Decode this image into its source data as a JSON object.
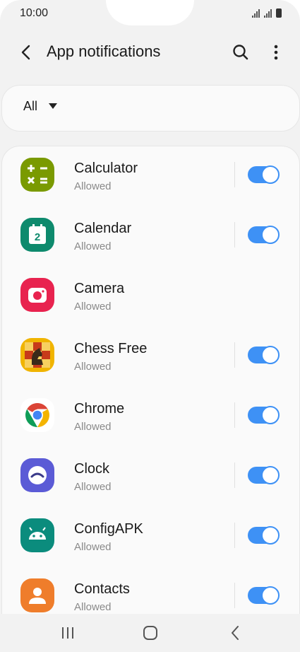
{
  "status": {
    "time": "10:00"
  },
  "header": {
    "title": "App notifications"
  },
  "filter": {
    "selected": "All"
  },
  "apps": [
    {
      "name": "Calculator",
      "status": "Allowed",
      "icon": "calculator-icon",
      "toggle": true,
      "enabled": true
    },
    {
      "name": "Calendar",
      "status": "Allowed",
      "icon": "calendar-icon",
      "toggle": true,
      "enabled": true
    },
    {
      "name": "Camera",
      "status": "Allowed",
      "icon": "camera-icon",
      "toggle": false,
      "enabled": true
    },
    {
      "name": "Chess Free",
      "status": "Allowed",
      "icon": "chess-icon",
      "toggle": true,
      "enabled": true
    },
    {
      "name": "Chrome",
      "status": "Allowed",
      "icon": "chrome-icon",
      "toggle": true,
      "enabled": true
    },
    {
      "name": "Clock",
      "status": "Allowed",
      "icon": "clock-icon",
      "toggle": true,
      "enabled": true
    },
    {
      "name": "ConfigAPK",
      "status": "Allowed",
      "icon": "android-icon",
      "toggle": true,
      "enabled": true
    },
    {
      "name": "Contacts",
      "status": "Allowed",
      "icon": "contacts-icon",
      "toggle": true,
      "enabled": true
    }
  ],
  "colors": {
    "accent": "#3e91f5"
  }
}
